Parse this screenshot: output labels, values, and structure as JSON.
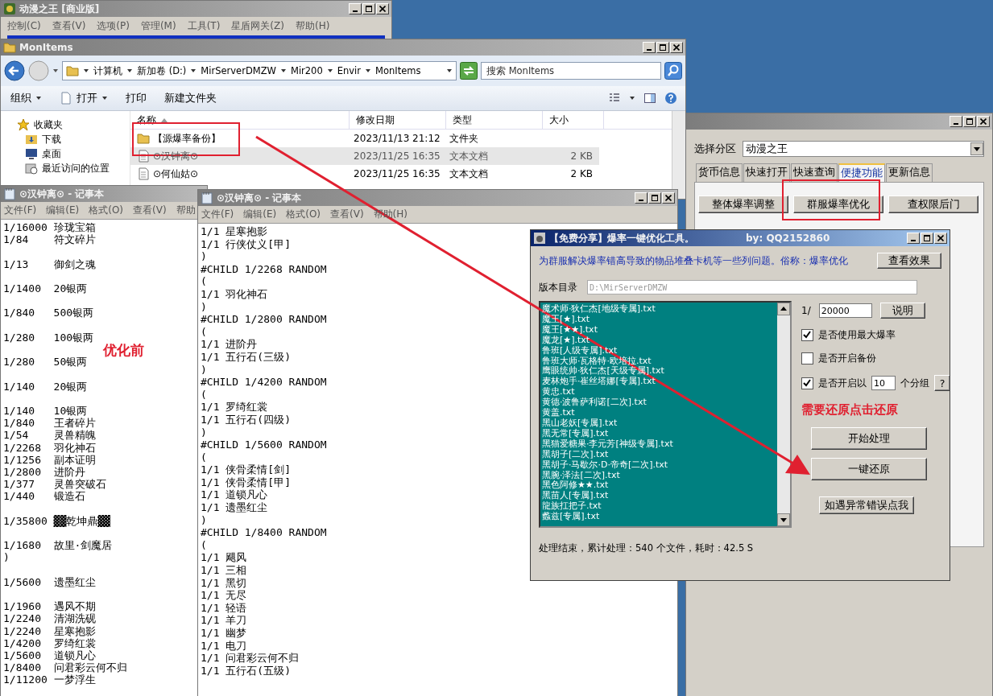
{
  "app_window": {
    "title": "动漫之王 [商业版]",
    "menu": [
      "控制(C)",
      "查看(V)",
      "选项(P)",
      "管理(M)",
      "工具(T)",
      "星盾网关(Z)",
      "帮助(H)"
    ]
  },
  "explorer": {
    "title": "MonItems",
    "breadcrumbs": [
      "计算机",
      "新加卷 (D:)",
      "MirServerDMZW",
      "Mir200",
      "Envir",
      "MonItems"
    ],
    "search": {
      "placeholder": "搜索 MonItems"
    },
    "toolbar": [
      {
        "label": "组织",
        "kind": "menu"
      },
      {
        "label": "打开",
        "kind": "open"
      },
      {
        "label": "打印",
        "kind": "plain"
      },
      {
        "label": "新建文件夹",
        "kind": "plain"
      }
    ],
    "sidebar": [
      {
        "label": "收藏夹",
        "kind": "star"
      },
      {
        "label": "下载",
        "kind": "download"
      },
      {
        "label": "桌面",
        "kind": "desktop"
      },
      {
        "label": "最近访问的位置",
        "kind": "recent"
      }
    ],
    "columns": [
      "名称",
      "修改日期",
      "类型",
      "大小"
    ],
    "rows": [
      {
        "name": "【源爆率备份】",
        "date": "2023/11/13 21:12",
        "type": "文件夹",
        "size": "",
        "kind": "folder",
        "selected": false
      },
      {
        "name": "⊙汉钟离⊙",
        "date": "2023/11/25 16:35",
        "type": "文本文档",
        "size": "2 KB",
        "kind": "file",
        "selected": true
      },
      {
        "name": "⊙何仙姑⊙",
        "date": "2023/11/25 16:35",
        "type": "文本文档",
        "size": "2 KB",
        "kind": "file",
        "selected": false
      }
    ]
  },
  "right_window": {
    "zone_label": "选择分区",
    "zone_value": "动漫之王",
    "tabs": [
      {
        "label": "货币信息",
        "selected": false
      },
      {
        "label": "快速打开",
        "selected": false
      },
      {
        "label": "快速查询",
        "selected": false
      },
      {
        "label": "便捷功能",
        "selected": true
      },
      {
        "label": "更新信息",
        "selected": false
      }
    ],
    "buttons": [
      "整体爆率调整",
      "群服爆率优化",
      "查权限后门"
    ]
  },
  "notepads": [
    {
      "kind": "pairs",
      "title": "⊙汉钟离⊙ - 记事本",
      "menu": [
        "文件(F)",
        "编辑(E)",
        "格式(O)",
        "查看(V)",
        "帮助"
      ],
      "blocks": [
        [
          {
            "rate": "1/16000",
            "name": "珍珑宝箱"
          },
          {
            "rate": "1/84",
            "name": "符文碎片"
          }
        ],
        [
          {
            "rate": "1/13",
            "name": "御剑之魂"
          }
        ],
        [
          {
            "rate": "1/1400",
            "name": "20银两"
          }
        ],
        [
          {
            "rate": "1/840",
            "name": "500银两"
          }
        ],
        [
          {
            "rate": "1/280",
            "name": "100银两"
          }
        ],
        [
          {
            "rate": "1/280",
            "name": "50银两"
          }
        ],
        [
          {
            "rate": "1/140",
            "name": "20银两"
          }
        ],
        [
          {
            "rate": "1/140",
            "name": "10银两"
          },
          {
            "rate": "1/840",
            "name": "王者碎片"
          },
          {
            "rate": "1/54",
            "name": "灵兽精魄"
          },
          {
            "rate": "1/2268",
            "name": "羽化神石"
          },
          {
            "rate": "1/1256",
            "name": "副本证明"
          },
          {
            "rate": "1/2800",
            "name": "进阶丹"
          },
          {
            "rate": "1/377",
            "name": "灵兽突破石"
          },
          {
            "rate": "1/440",
            "name": "锻造石"
          }
        ],
        [
          {
            "rate": "1/35800",
            "name": "▓▓乾坤鼎▓▓"
          }
        ],
        [
          {
            "rate": "1/1680",
            "name": "故里·剑魔居"
          },
          {
            "rate": ")"
          }
        ],
        [
          {
            "rate": "1/5600",
            "name": "遗墨红尘"
          }
        ],
        [
          {
            "rate": "1/1960",
            "name": "遇风不期"
          },
          {
            "rate": "1/2240",
            "name": "清湖洗砚"
          },
          {
            "rate": "1/2240",
            "name": "星寒抱影"
          },
          {
            "rate": "1/4200",
            "name": "罗绮红裳"
          },
          {
            "rate": "1/5600",
            "name": "道锁凡心"
          },
          {
            "rate": "1/8400",
            "name": "问君彩云何不归"
          },
          {
            "rate": "1/11200",
            "name": "一梦浮生"
          }
        ]
      ]
    },
    {
      "kind": "lines",
      "title": "⊙汉钟离⊙ - 记事本",
      "menu": [
        "文件(F)",
        "编辑(E)",
        "格式(O)",
        "查看(V)",
        "帮助(H)"
      ],
      "lines": [
        "1/1 星寒抱影",
        "1/1 行侠仗义[甲]",
        ")",
        "#CHILD 1/2268 RANDOM",
        "(",
        "1/1 羽化神石",
        ")",
        "#CHILD 1/2800 RANDOM",
        "(",
        "1/1 进阶丹",
        "1/1 五行石(三级)",
        ")",
        "#CHILD 1/4200 RANDOM",
        "(",
        "1/1 罗绮红裳",
        "1/1 五行石(四级)",
        ")",
        "#CHILD 1/5600 RANDOM",
        "(",
        "1/1 侠骨柔情[剑]",
        "1/1 侠骨柔情[甲]",
        "1/1 道锁凡心",
        "1/1 遗墨红尘",
        ")",
        "#CHILD 1/8400 RANDOM",
        "(",
        "1/1 飓风",
        "1/1 三相",
        "1/1 黑切",
        "1/1 无尽",
        "1/1 轻语",
        "1/1 羊刀",
        "1/1 幽梦",
        "1/1 电刀",
        "1/1 问君彩云何不归",
        "1/1 五行石(五级)"
      ]
    }
  ],
  "tool": {
    "title": "【免费分享】爆率一键优化工具。",
    "author": "by: QQ2152860",
    "description": "为群服解决爆率错高导致的物品堆叠卡机等一些列问题。俗称：爆率优化",
    "view_button": "查看效果",
    "dir_label": "版本目录",
    "dir_value": "D:\\MirServerDMZW",
    "files": [
      "魔术师·狄仁杰[地级专属].txt",
      "魔王[★].txt",
      "魔王[★★].txt",
      "魔龙[★].txt",
      "鲁班[人级专属].txt",
      "鲁班大师·瓦格特·欧培拉.txt",
      "鹰眼统帅·狄仁杰[天级专属].txt",
      "麦林炮手·崔丝塔娜[专属].txt",
      "黄忠.txt",
      "黄德·波鲁萨利诺[二次].txt",
      "黄盖.txt",
      "黑山老妖[专属].txt",
      "黑无常[专属].txt",
      "黑猫爱糖果·李元芳[神级专属].txt",
      "黑胡子[二次].txt",
      "黑胡子·马歇尔·D·帝奇[二次].txt",
      "黑腕·泽法[二次].txt",
      "黑色阿修★★.txt",
      "黑苗人[专属].txt",
      "龍族扛把子.txt",
      "蠡兹[专属].txt"
    ],
    "rate_prefix": "1/",
    "rate_value": "20000",
    "explain_button": "说明",
    "options": [
      {
        "label": "是否使用最大爆率",
        "checked": true
      },
      {
        "label": "是否开启备份",
        "checked": false
      }
    ],
    "group_option": {
      "label": "是否开启以",
      "value": "10",
      "suffix": "个分组",
      "checked": true,
      "help_button": "?"
    },
    "actions": [
      "开始处理",
      "一键还原"
    ],
    "error_button": "如遇异常错误点我",
    "status": "处理结束，累计处理：540 个文件，耗时：42.5 S"
  },
  "annotations": {
    "before_label": "优化前",
    "restore_hint": "需要还原点击还原"
  }
}
